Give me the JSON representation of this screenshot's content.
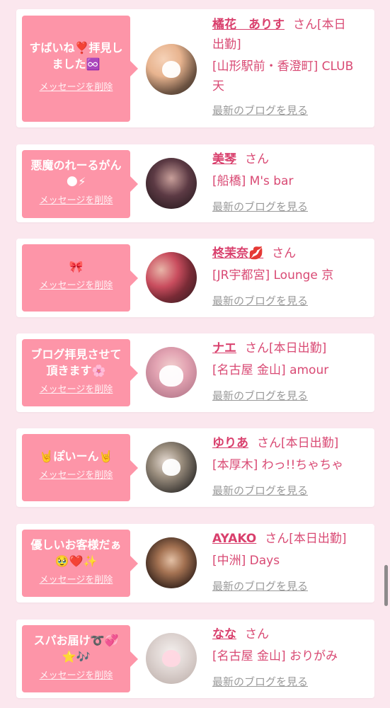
{
  "colors": {
    "background": "#fbe7ee",
    "bubble": "#fd95a8",
    "accent": "#d9406d",
    "link_gray": "#9a9a9a"
  },
  "delete_label": "メッセージを削除",
  "blog_label": "最新のブログを見る",
  "items": [
    {
      "message_line1": "すばいね❣️拝見し",
      "message_line2": "ました♾️",
      "name": "橘花　ありす",
      "suffix": "さん[本日",
      "name_line2": "出勤]",
      "location": "[山形駅前・香澄町] CLUB",
      "location_line2": "天",
      "avatar_icon": "heart-sticker-icon"
    },
    {
      "message_line1": "悪魔のれーるがん",
      "message_line2": "🌑⚡",
      "name": "美琴",
      "suffix": "さん",
      "location": "[船橋] M's bar"
    },
    {
      "message_line1": "🎀",
      "name": "柊茉奈💋",
      "suffix": "さん",
      "location": "[JR宇都宮] Lounge 京"
    },
    {
      "message_line1": "ブログ拝見させて",
      "message_line2": "頂きます🌸",
      "name": "ナエ",
      "suffix": "さん[本日出勤]",
      "location": "[名古屋 金山] amour",
      "avatar_icon": "cat-sticker-icon"
    },
    {
      "message_line1": "🤘ぽいーん🤘",
      "name": "ゆりあ",
      "suffix": "さん[本日出勤]",
      "location": "[本厚木] わっ!!ちゃちゃ",
      "avatar_icon": "heart-sticker-icon"
    },
    {
      "message_line1": "優しいお客様だぁ",
      "message_line2": "🥹❤️✨",
      "name": "AYAKO",
      "suffix": "さん[本日出勤]",
      "location": "[中洲] Days"
    },
    {
      "message_line1": "スパお届け➰💞",
      "message_line2": "⭐🎶",
      "name": "なな",
      "suffix": "さん",
      "location": "[名古屋 金山] おりがみ",
      "avatar_icon": "heart-sticker-icon"
    }
  ]
}
